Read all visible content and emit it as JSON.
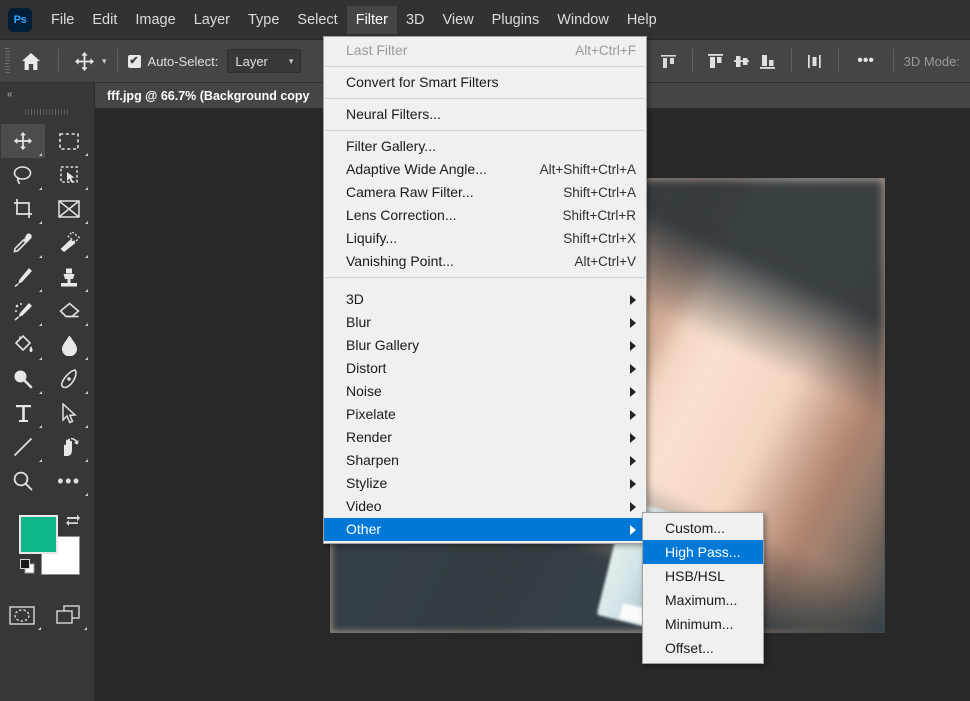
{
  "app": {
    "logo_text": "Ps",
    "menubar": [
      {
        "label": "File"
      },
      {
        "label": "Edit"
      },
      {
        "label": "Image"
      },
      {
        "label": "Layer"
      },
      {
        "label": "Type"
      },
      {
        "label": "Select"
      },
      {
        "label": "Filter",
        "active": true
      },
      {
        "label": "3D"
      },
      {
        "label": "View"
      },
      {
        "label": "Plugins"
      },
      {
        "label": "Window"
      },
      {
        "label": "Help"
      }
    ]
  },
  "options_bar": {
    "home_icon": "home-icon",
    "move_tool_icon": "move-tool-icon",
    "auto_select_checked": "✔",
    "auto_select_label": "Auto-Select:",
    "layer_dropdown_value": "Layer",
    "align_icons": [
      "align-top-icon",
      "align-vertical-center-icon",
      "align-bottom-icon",
      "distribute-icon"
    ],
    "more_options_label": "•••",
    "mode_3d_label": "3D Mode:"
  },
  "toolbar": {
    "collapse_label": "«",
    "tools": [
      {
        "name": "move-tool",
        "glyph": "move",
        "selected": true
      },
      {
        "name": "rectangular-marquee-tool",
        "glyph": "marquee"
      },
      {
        "name": "lasso-tool",
        "glyph": "lasso"
      },
      {
        "name": "object-selection-tool",
        "glyph": "objsel"
      },
      {
        "name": "crop-tool",
        "glyph": "crop"
      },
      {
        "name": "frame-tool",
        "glyph": "frame"
      },
      {
        "name": "eyedropper-tool",
        "glyph": "eyedropper"
      },
      {
        "name": "spot-healing-brush-tool",
        "glyph": "healing"
      },
      {
        "name": "brush-tool",
        "glyph": "brush"
      },
      {
        "name": "clone-stamp-tool",
        "glyph": "stamp"
      },
      {
        "name": "history-brush-tool",
        "glyph": "historybrush"
      },
      {
        "name": "eraser-tool",
        "glyph": "eraser"
      },
      {
        "name": "gradient-tool",
        "glyph": "paintbucket"
      },
      {
        "name": "blur-tool",
        "glyph": "blur"
      },
      {
        "name": "dodge-tool",
        "glyph": "dodge"
      },
      {
        "name": "pen-tool",
        "glyph": "pen"
      },
      {
        "name": "type-tool",
        "glyph": "type"
      },
      {
        "name": "path-selection-tool",
        "glyph": "pathsel"
      },
      {
        "name": "line-tool",
        "glyph": "line"
      },
      {
        "name": "rotate-view-tool",
        "glyph": "rotateview"
      },
      {
        "name": "zoom-tool",
        "glyph": "zoom"
      },
      {
        "name": "edit-toolbar",
        "glyph": "dots"
      }
    ],
    "foreground_color": "#0FB786",
    "background_color": "#FFFFFF",
    "default_colors_icon": "default-colors-icon",
    "swap_colors_icon": "swap-colors-icon",
    "quick_mask_icon": "quick-mask-icon",
    "screen_mode_icon": "screen-mode-icon"
  },
  "document": {
    "tab_title": "fff.jpg @ 66.7% (Background copy",
    "zoom_level": "66.7%",
    "file_name": "fff.jpg",
    "layer_name": "Background copy",
    "canvas_background": "#282828",
    "image_alt_text": "kin"
  },
  "filter_menu": {
    "sections": [
      [
        {
          "label": "Last Filter",
          "accel": "Alt+Ctrl+F",
          "disabled": true
        }
      ],
      [
        {
          "label": "Convert for Smart Filters",
          "accel": ""
        }
      ],
      [
        {
          "label": "Neural Filters...",
          "accel": ""
        }
      ],
      [
        {
          "label": "Filter Gallery...",
          "accel": ""
        },
        {
          "label": "Adaptive Wide Angle...",
          "accel": "Alt+Shift+Ctrl+A"
        },
        {
          "label": "Camera Raw Filter...",
          "accel": "Shift+Ctrl+A"
        },
        {
          "label": "Lens Correction...",
          "accel": "Shift+Ctrl+R"
        },
        {
          "label": "Liquify...",
          "accel": "Shift+Ctrl+X"
        },
        {
          "label": "Vanishing Point...",
          "accel": "Alt+Ctrl+V"
        }
      ],
      [
        {
          "label": "3D",
          "submenu": true
        },
        {
          "label": "Blur",
          "submenu": true
        },
        {
          "label": "Blur Gallery",
          "submenu": true
        },
        {
          "label": "Distort",
          "submenu": true
        },
        {
          "label": "Noise",
          "submenu": true
        },
        {
          "label": "Pixelate",
          "submenu": true
        },
        {
          "label": "Render",
          "submenu": true
        },
        {
          "label": "Sharpen",
          "submenu": true
        },
        {
          "label": "Stylize",
          "submenu": true
        },
        {
          "label": "Video",
          "submenu": true
        },
        {
          "label": "Other",
          "submenu": true,
          "highlight": true
        }
      ]
    ]
  },
  "other_submenu": {
    "items": [
      {
        "label": "Custom..."
      },
      {
        "label": "High Pass...",
        "highlight": true
      },
      {
        "label": "HSB/HSL"
      },
      {
        "label": "Maximum..."
      },
      {
        "label": "Minimum..."
      },
      {
        "label": "Offset..."
      }
    ]
  },
  "colors": {
    "menu_highlight": "#0078D7",
    "menu_background": "#F0F0F0",
    "chrome_dark": "#323232",
    "chrome_mid": "#454545",
    "toolbar_bg": "#373737"
  }
}
